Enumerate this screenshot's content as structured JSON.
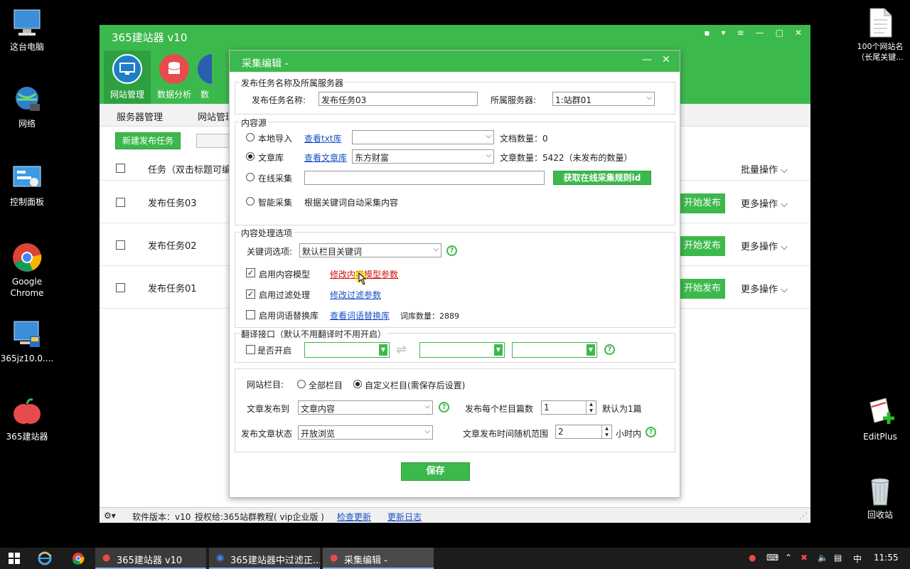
{
  "desktop_icons": [
    {
      "label": "这台电脑",
      "icon": "computer-icon"
    },
    {
      "label": "网络",
      "icon": "network-globe-icon"
    },
    {
      "label": "控制面板",
      "icon": "control-panel-icon"
    },
    {
      "label": "Google Chrome",
      "icon": "chrome-icon"
    },
    {
      "label": "365jz10.0....",
      "icon": "installer-icon"
    },
    {
      "label": "365建站器",
      "icon": "apple-app-icon"
    },
    {
      "label": "100个网站名（长尾关键...",
      "icon": "text-file-icon"
    },
    {
      "label": "EditPlus",
      "icon": "editplus-icon"
    },
    {
      "label": "回收站",
      "icon": "recycle-bin-icon"
    }
  ],
  "main_window": {
    "title": "365建站器 v10",
    "nav": [
      {
        "label": "网站管理",
        "icon": "monitor-icon",
        "color": "#1e7fc4"
      },
      {
        "label": "数据分析",
        "icon": "database-icon",
        "color": "#e84b4b"
      },
      {
        "label": "数",
        "icon": "data-icon",
        "color": "#2a5fb0"
      }
    ],
    "subnav": [
      "服务器管理",
      "网站管理"
    ],
    "new_task_label": "新建发布任务",
    "table_header": {
      "task": "任务（双击标题可编辑",
      "batch": "批量操作"
    },
    "rows": [
      {
        "name": "发布任务03",
        "start": "开始发布",
        "more": "更多操作"
      },
      {
        "name": "发布任务02",
        "start": "开始发布",
        "more": "更多操作"
      },
      {
        "name": "发布任务01",
        "start": "开始发布",
        "more": "更多操作"
      }
    ],
    "status": {
      "version": "软件版本：v10",
      "license": "授权给:365站群教程( vip企业版 )",
      "check_update": "检查更新",
      "changelog": "更新日志"
    }
  },
  "dialog": {
    "title": "采集编辑 -",
    "section1": {
      "legend": "发布任务名称及所属服务器",
      "name_label": "发布任务名称:",
      "name_value": "发布任务03",
      "server_label": "所属服务器:",
      "server_value": "1:站群01"
    },
    "section2": {
      "legend": "内容源",
      "local_label": "本地导入",
      "local_link": "查看txt库",
      "doc_count": "文档数量：0",
      "lib_label": "文章库",
      "lib_link": "查看文章库",
      "lib_value": "东方财富",
      "article_count": "文章数量：5422（未发布的数量）",
      "online_label": "在线采集",
      "online_btn": "获取在线采集规则id",
      "smart_label": "智能采集",
      "smart_desc": "根据关键词自动采集内容"
    },
    "section3": {
      "legend": "内容处理选项",
      "keyword_label": "关键词选项:",
      "keyword_value": "默认栏目关键词",
      "model_label": "启用内容模型",
      "model_link": "修改内容模型参数",
      "filter_label": "启用过滤处理",
      "filter_link": "修改过滤参数",
      "synonym_label": "启用词语替换库",
      "synonym_link": "查看词语替换库",
      "synonym_count": "词库数量：2889"
    },
    "section4": {
      "legend": "翻译接口（默认不用翻译时不用开启）",
      "enable_label": "是否开启"
    },
    "section5": {
      "column_label": "网站栏目:",
      "all_columns": "全部栏目",
      "custom_columns": "自定义栏目(需保存后设置)",
      "publish_to_label": "文章发布到",
      "publish_to_value": "文章内容",
      "per_column_label": "发布每个栏目篇数",
      "per_column_value": "1",
      "default_note": "默认为1篇",
      "status_label": "发布文章状态",
      "status_value": "开放浏览",
      "time_range_label": "文章发布时间随机范围",
      "time_range_value": "2",
      "hours_unit": "小时内"
    },
    "save_label": "保存"
  },
  "taskbar": {
    "tasks": [
      "365建站器 v10",
      "365建站器中过滤正...",
      "采集编辑 -"
    ],
    "ime": "中",
    "time": "11:55"
  },
  "colors": {
    "accent": "#3cb94c",
    "link": "#1a4fc7",
    "link_hover": "#d01010"
  }
}
